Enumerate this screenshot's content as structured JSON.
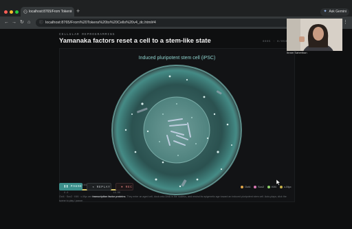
{
  "browser": {
    "tab_title": "localhost:8765/From Tokens",
    "tab_close": "×",
    "new_tab": "+",
    "ask_button": "Ask Gemini",
    "url": "localhost:8765/From%20Tokens%20to%20Cells%20v4_dc.html#4",
    "nav": {
      "back": "←",
      "forward": "→",
      "reload": "↻",
      "home": "⌂",
      "menu": "⋮"
    },
    "traffic_lights": [
      "#ff5f57",
      "#febc2e",
      "#28c840"
    ]
  },
  "slide": {
    "eyebrow": "CELLULAR REPROGRAMMING",
    "title": "Yamanaka factors reset a cell to a stem-like state",
    "page_count": "0005 · 0/050",
    "cell_label": "Induced pluripotent stem cell (iPSC)",
    "progress": {
      "label": "REPROGRAMMING",
      "fraction": 0.97,
      "start": "0.0",
      "end": "10.00"
    }
  },
  "controls": {
    "pause": "❚❚ PAUSE",
    "replay": "◂ REPLAY",
    "rec": "● REC"
  },
  "legend": [
    {
      "label": "Oct4",
      "color": "#e0a64a"
    },
    {
      "label": "Sox2",
      "color": "#d97ab6"
    },
    {
      "label": "Klf4",
      "color": "#8fd36a"
    },
    {
      "label": "c-Myc",
      "color": "#c8b04a"
    }
  ],
  "caption": {
    "lead": "Oct4 · Sox2 · Klf4 · c-Myc are ",
    "bold": "transcription factor proteins",
    "rest": ". They enter an aged cell, dock onto DNA in the nucleus, and rewind its epigenetic age toward an induced pluripotent stem cell. Auto-plays; click the scene to play / pause."
  },
  "video_call": {
    "name": "Ibram Saheriban"
  },
  "colors": {
    "accent": "#3c8f8b",
    "cell_glow": "#7fd3cb",
    "progress": "#d8c66b"
  }
}
